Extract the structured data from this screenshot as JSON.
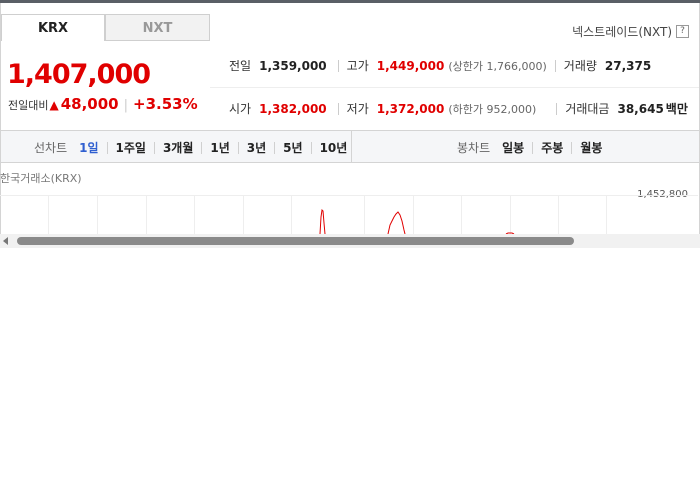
{
  "tabs": {
    "krx": "KRX",
    "nxt": "NXT"
  },
  "nextrade_link": "넥스트레이드(NXT)",
  "help_glyph": "?",
  "price": {
    "current": "1,407,000",
    "change_label": "전일대비",
    "change_value": "48,000",
    "change_pct": "+3.53%"
  },
  "stats": {
    "prev_close": {
      "label": "전일",
      "value": "1,359,000"
    },
    "high": {
      "label": "고가",
      "value": "1,449,000",
      "limit_label": "상한가",
      "limit_value": "1,766,000"
    },
    "volume": {
      "label": "거래량",
      "value": "27,375"
    },
    "open": {
      "label": "시가",
      "value": "1,382,000"
    },
    "low": {
      "label": "저가",
      "value": "1,372,000",
      "limit_label": "하한가",
      "limit_value": "952,000"
    },
    "amount": {
      "label": "거래대금",
      "value": "38,645",
      "unit": "백만"
    }
  },
  "toolbar": {
    "line_chart_label": "선차트",
    "line_periods": [
      "1일",
      "1주일",
      "3개월",
      "1년",
      "3년",
      "5년",
      "10년"
    ],
    "active_period": "1일",
    "candle_chart_label": "봉차트",
    "candle_periods": [
      "일봉",
      "주봉",
      "월봉"
    ]
  },
  "chart": {
    "exchange_label": "한국거래소(KRX)",
    "y_tick_top": "1,452,800",
    "line_color": "#e00000",
    "grid_color": "#eeeeee"
  },
  "colors": {
    "up": "#e00000",
    "active": "#2f5fd0"
  }
}
